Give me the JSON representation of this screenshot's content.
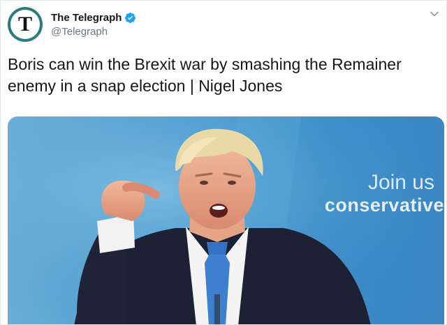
{
  "account": {
    "display_name": "The Telegraph",
    "handle": "@Telegraph",
    "avatar_letter": "T",
    "verified": true,
    "avatar_color": "#2a7d7f"
  },
  "tweet": {
    "text": "Boris can win the Brexit war by smashing the Remainer enemy in a snap election | Nigel Jones"
  },
  "media": {
    "sign_line1": "Join us",
    "sign_line2": "conservative"
  },
  "icons": {
    "verified": "verified-badge-icon",
    "menu": "chevron-down-icon"
  },
  "colors": {
    "text": "#14171a",
    "secondary": "#657786",
    "verified": "#1da1f2",
    "border": "#e1e8ed"
  }
}
